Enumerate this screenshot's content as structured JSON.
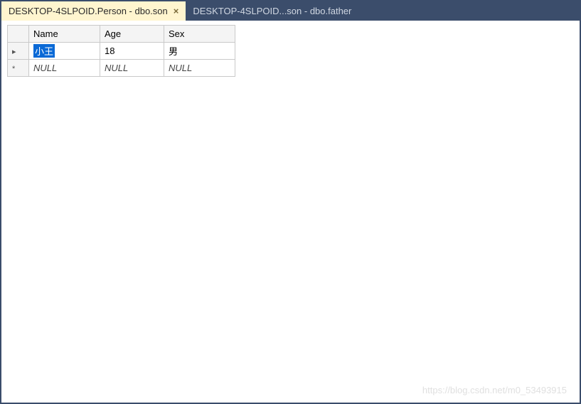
{
  "tabs": [
    {
      "label": "DESKTOP-4SLPOID.Person - dbo.son",
      "active": true,
      "closable": true
    },
    {
      "label": "DESKTOP-4SLPOID...son - dbo.father",
      "active": false,
      "closable": false
    }
  ],
  "grid": {
    "columns": [
      {
        "header": "Name"
      },
      {
        "header": "Age"
      },
      {
        "header": "Sex"
      }
    ],
    "rows": [
      {
        "indicator": "▸",
        "cells": [
          {
            "value": "小王",
            "selected": true,
            "null": false
          },
          {
            "value": "18",
            "selected": false,
            "null": false
          },
          {
            "value": "男",
            "selected": false,
            "null": false
          }
        ]
      },
      {
        "indicator": "*",
        "cells": [
          {
            "value": "NULL",
            "selected": false,
            "null": true
          },
          {
            "value": "NULL",
            "selected": false,
            "null": true
          },
          {
            "value": "NULL",
            "selected": false,
            "null": true
          }
        ]
      }
    ]
  },
  "watermark": "https://blog.csdn.net/m0_53493915"
}
